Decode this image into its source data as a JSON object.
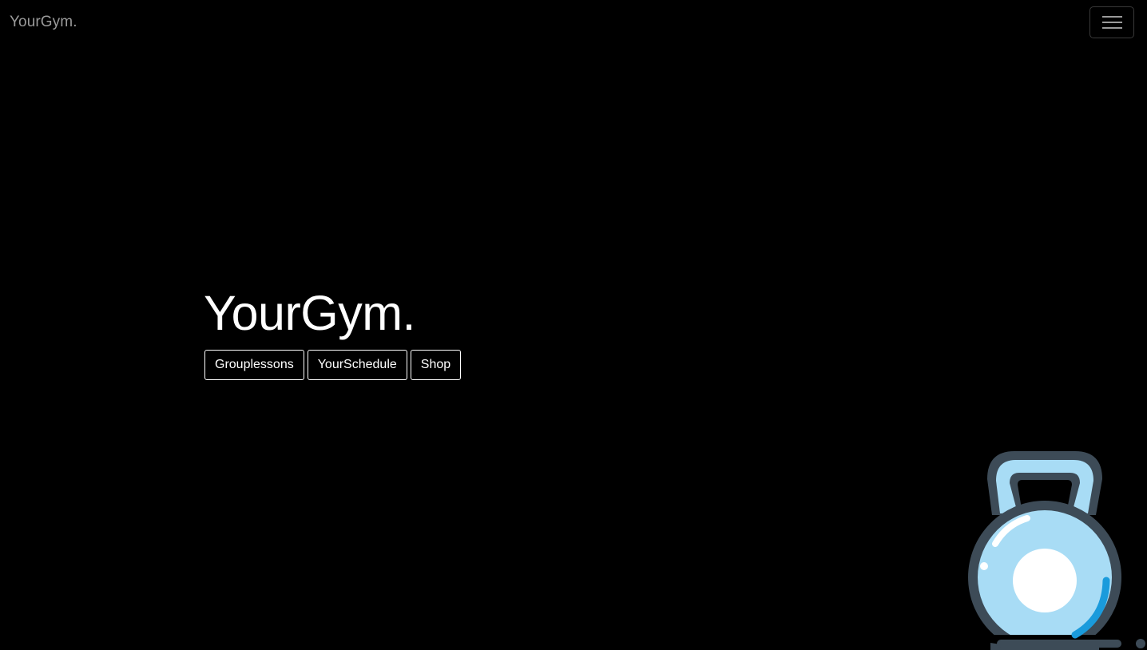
{
  "navbar": {
    "brand": "YourGym.",
    "menu_icon": "hamburger-menu-icon"
  },
  "hero": {
    "title": "YourGym.",
    "buttons": [
      {
        "label": "Grouplessons"
      },
      {
        "label": "YourSchedule"
      },
      {
        "label": "Shop"
      }
    ]
  },
  "illustration": {
    "icon": "kettlebell-icon",
    "colors": {
      "body_fill": "#a8dcf5",
      "outline": "#3d4b57",
      "accent": "#1a9bdc",
      "highlight": "#ffffff"
    }
  },
  "colors": {
    "background": "#000000",
    "brand_text": "#9a9a9a",
    "hero_text": "#ffffff"
  }
}
